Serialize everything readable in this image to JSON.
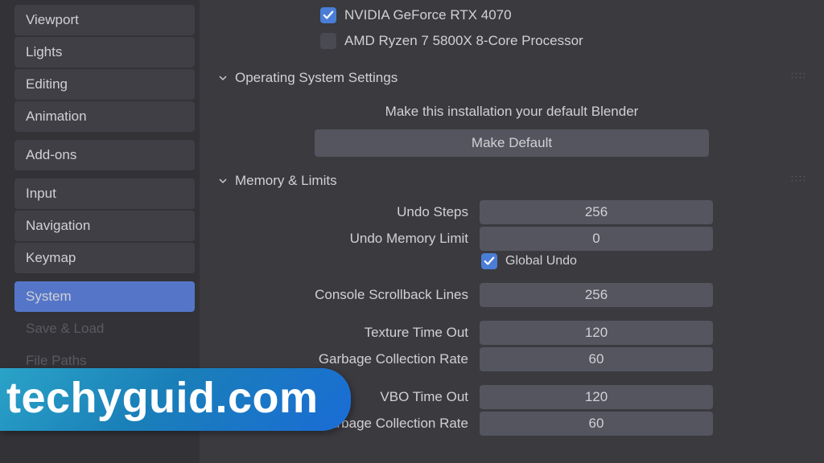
{
  "sidebar": {
    "items": [
      {
        "label": "Viewport"
      },
      {
        "label": "Lights"
      },
      {
        "label": "Editing"
      },
      {
        "label": "Animation"
      },
      {
        "label": "Add-ons",
        "gap_before": true
      },
      {
        "label": "Input",
        "gap_before": true
      },
      {
        "label": "Navigation"
      },
      {
        "label": "Keymap"
      },
      {
        "label": "System",
        "gap_before": true,
        "active": true
      },
      {
        "label": "Save & Load",
        "dim": true
      },
      {
        "label": "File Paths",
        "dim": true
      }
    ]
  },
  "devices": {
    "items": [
      {
        "label": "NVIDIA GeForce RTX 4070",
        "checked": true
      },
      {
        "label": "AMD Ryzen 7 5800X 8-Core Processor",
        "checked": false
      }
    ]
  },
  "os_section": {
    "title": "Operating System Settings",
    "description": "Make this installation your default Blender",
    "button": "Make Default"
  },
  "mem_section": {
    "title": "Memory & Limits",
    "rows": [
      {
        "label": "Undo Steps",
        "value": "256"
      },
      {
        "label": "Undo Memory Limit",
        "value": "0"
      },
      {
        "type": "check",
        "label": "Global Undo",
        "checked": true
      },
      {
        "type": "spacer"
      },
      {
        "label": "Console Scrollback Lines",
        "value": "256"
      },
      {
        "type": "spacer"
      },
      {
        "label": "Texture Time Out",
        "value": "120"
      },
      {
        "label": "Garbage Collection Rate",
        "value": "60"
      },
      {
        "type": "spacer"
      },
      {
        "label": "VBO Time Out",
        "value": "120"
      },
      {
        "label": "Garbage Collection Rate",
        "value": "60"
      }
    ]
  },
  "watermark": "techyguid.com"
}
